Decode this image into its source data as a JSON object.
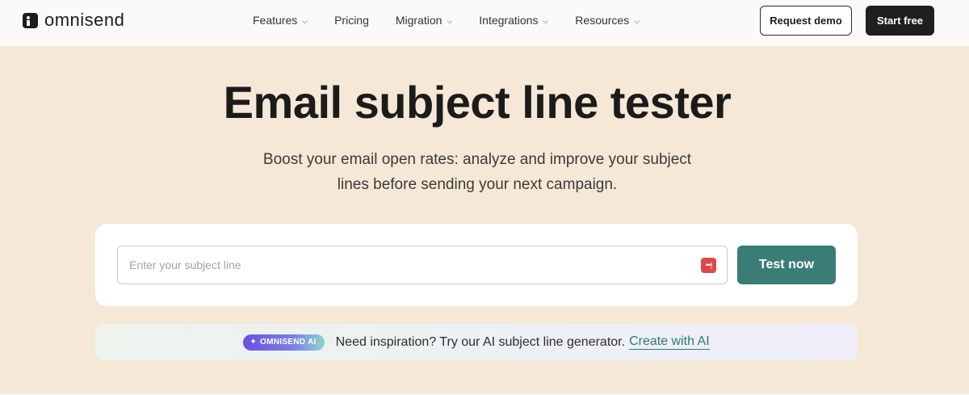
{
  "header": {
    "logo_text": "omnisend",
    "nav": [
      {
        "label": "Features",
        "dropdown": true
      },
      {
        "label": "Pricing",
        "dropdown": false
      },
      {
        "label": "Migration",
        "dropdown": true
      },
      {
        "label": "Integrations",
        "dropdown": true
      },
      {
        "label": "Resources",
        "dropdown": true
      }
    ],
    "request_demo_label": "Request demo",
    "start_free_label": "Start free"
  },
  "hero": {
    "title": "Email subject line tester",
    "subtitle_line1": "Boost your email open rates: analyze and improve your subject",
    "subtitle_line2": "lines before sending your next campaign."
  },
  "tester": {
    "input_value": "",
    "input_placeholder": "Enter your subject line",
    "password_icon_glyph": "•••|",
    "test_button_label": "Test now"
  },
  "banner": {
    "badge_label": "OMNISEND AI",
    "text": "Need inspiration? Try our AI subject line generator.",
    "link_label": "Create with AI"
  },
  "colors": {
    "background": "#f5e8d6",
    "accent": "#3a7d76",
    "dark_button": "#1f1f1f",
    "password_icon": "#e04848"
  }
}
